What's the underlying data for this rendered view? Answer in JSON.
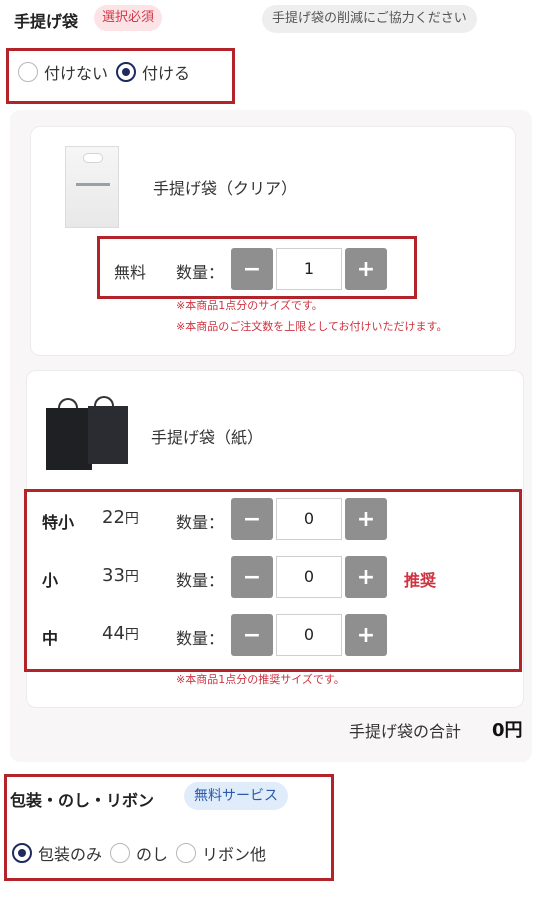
{
  "header": {
    "title": "手提げ袋",
    "required_badge": "選択必須",
    "reduce_note": "手提げ袋の削減にご協力ください"
  },
  "bag_option": {
    "options": [
      {
        "label": "付けない",
        "selected": false
      },
      {
        "label": "付ける",
        "selected": true
      }
    ]
  },
  "clear_bag": {
    "name": "手提げ袋（クリア）",
    "price": "無料",
    "qty_label": "数量：",
    "qty": "1",
    "note1": "※本商品1点分のサイズです。",
    "note2": "※本商品のご注文数を上限としてお付けいただけます。"
  },
  "paper_bag": {
    "name": "手提げ袋（紙）",
    "qty_label": "数量：",
    "rows": [
      {
        "size": "特小",
        "price": "22",
        "unit": "円",
        "qty": "0",
        "tag": ""
      },
      {
        "size": "小",
        "price": "33",
        "unit": "円",
        "qty": "0",
        "tag": "推奨"
      },
      {
        "size": "中",
        "price": "44",
        "unit": "円",
        "qty": "0",
        "tag": ""
      }
    ],
    "note": "※本商品1点分の推奨サイズです。"
  },
  "controls": {
    "minus": "−",
    "plus": "+"
  },
  "total": {
    "label": "手提げ袋の合計",
    "value": "0円"
  },
  "wrapping": {
    "title": "包装・のし・リボン",
    "badge": "無料サービス",
    "options": [
      {
        "label": "包装のみ",
        "selected": true
      },
      {
        "label": "のし",
        "selected": false
      },
      {
        "label": "リボン他",
        "selected": false
      }
    ]
  },
  "colors": {
    "accent_navy": "#1d2b5e",
    "highlight_red": "#b3232a",
    "warning_red": "#d0323f"
  }
}
